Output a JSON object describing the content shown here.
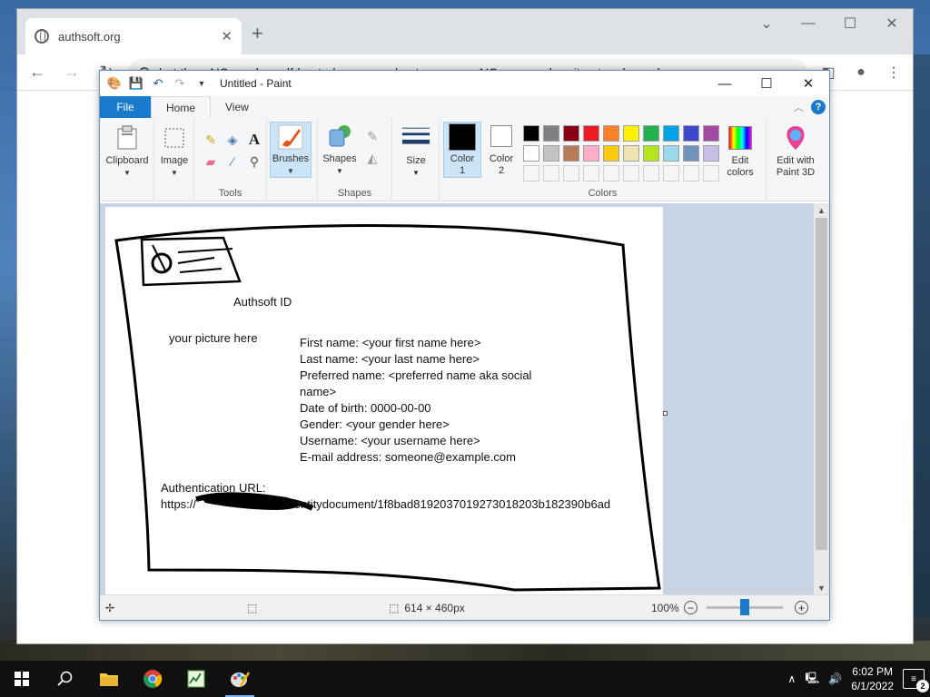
{
  "browser": {
    "tab_title": "authsoft.org",
    "omnibox_text": "but then AIS can be self-hosted - you can host your own AIS server when it gets released."
  },
  "paint": {
    "window_title": "Untitled - Paint",
    "tabs": [
      {
        "label": "File"
      },
      {
        "label": "Home"
      },
      {
        "label": "View"
      }
    ],
    "ribbon": {
      "clipboard": "Clipboard",
      "image": "Image",
      "tools_group": "Tools",
      "brushes": "Brushes",
      "shapes_btn": "Shapes",
      "shapes_group": "Shapes",
      "size": "Size",
      "color1_line1": "Color",
      "color1_line2": "1",
      "color2_line1": "Color",
      "color2_line2": "2",
      "colors_group": "Colors",
      "edit_colors_line1": "Edit",
      "edit_colors_line2": "colors",
      "paint3d_line1": "Edit with",
      "paint3d_line2": "Paint 3D"
    },
    "colors": {
      "color1": "#000000",
      "color2": "#ffffff",
      "palette_row1": [
        "#000000",
        "#7f7f7f",
        "#880015",
        "#ed1c24",
        "#ff7f27",
        "#fff200",
        "#22b14c",
        "#00a2e8",
        "#3f48cc",
        "#a349a4"
      ],
      "palette_row2": [
        "#ffffff",
        "#c3c3c3",
        "#b97a57",
        "#ffaec9",
        "#ffc90e",
        "#efe4b0",
        "#b5e61d",
        "#99d9ea",
        "#7092be",
        "#c8bfe7"
      ]
    },
    "document": {
      "heading": "Authsoft ID",
      "picture_placeholder": "your picture here",
      "fields": [
        "First name: <your first name here>",
        "Last name: <your last name here>",
        "Preferred name: <preferred name aka social",
        "name>",
        "Date of birth: 0000-00-00",
        "Gender: <your gender here>",
        "Username: <your username here>",
        "E-mail address: someone@example.com"
      ],
      "auth_label": "Authentication URL:",
      "auth_prefix": "https://",
      "auth_suffix": "/identitydocument/1f8bad8192037019273018203b182390b6ad"
    },
    "status": {
      "canvas_size": "614 × 460px",
      "zoom": "100%",
      "zoom_level_fraction": 0.5
    }
  },
  "taskbar": {
    "time": "6:02 PM",
    "date": "6/1/2022",
    "notifications": "2"
  }
}
